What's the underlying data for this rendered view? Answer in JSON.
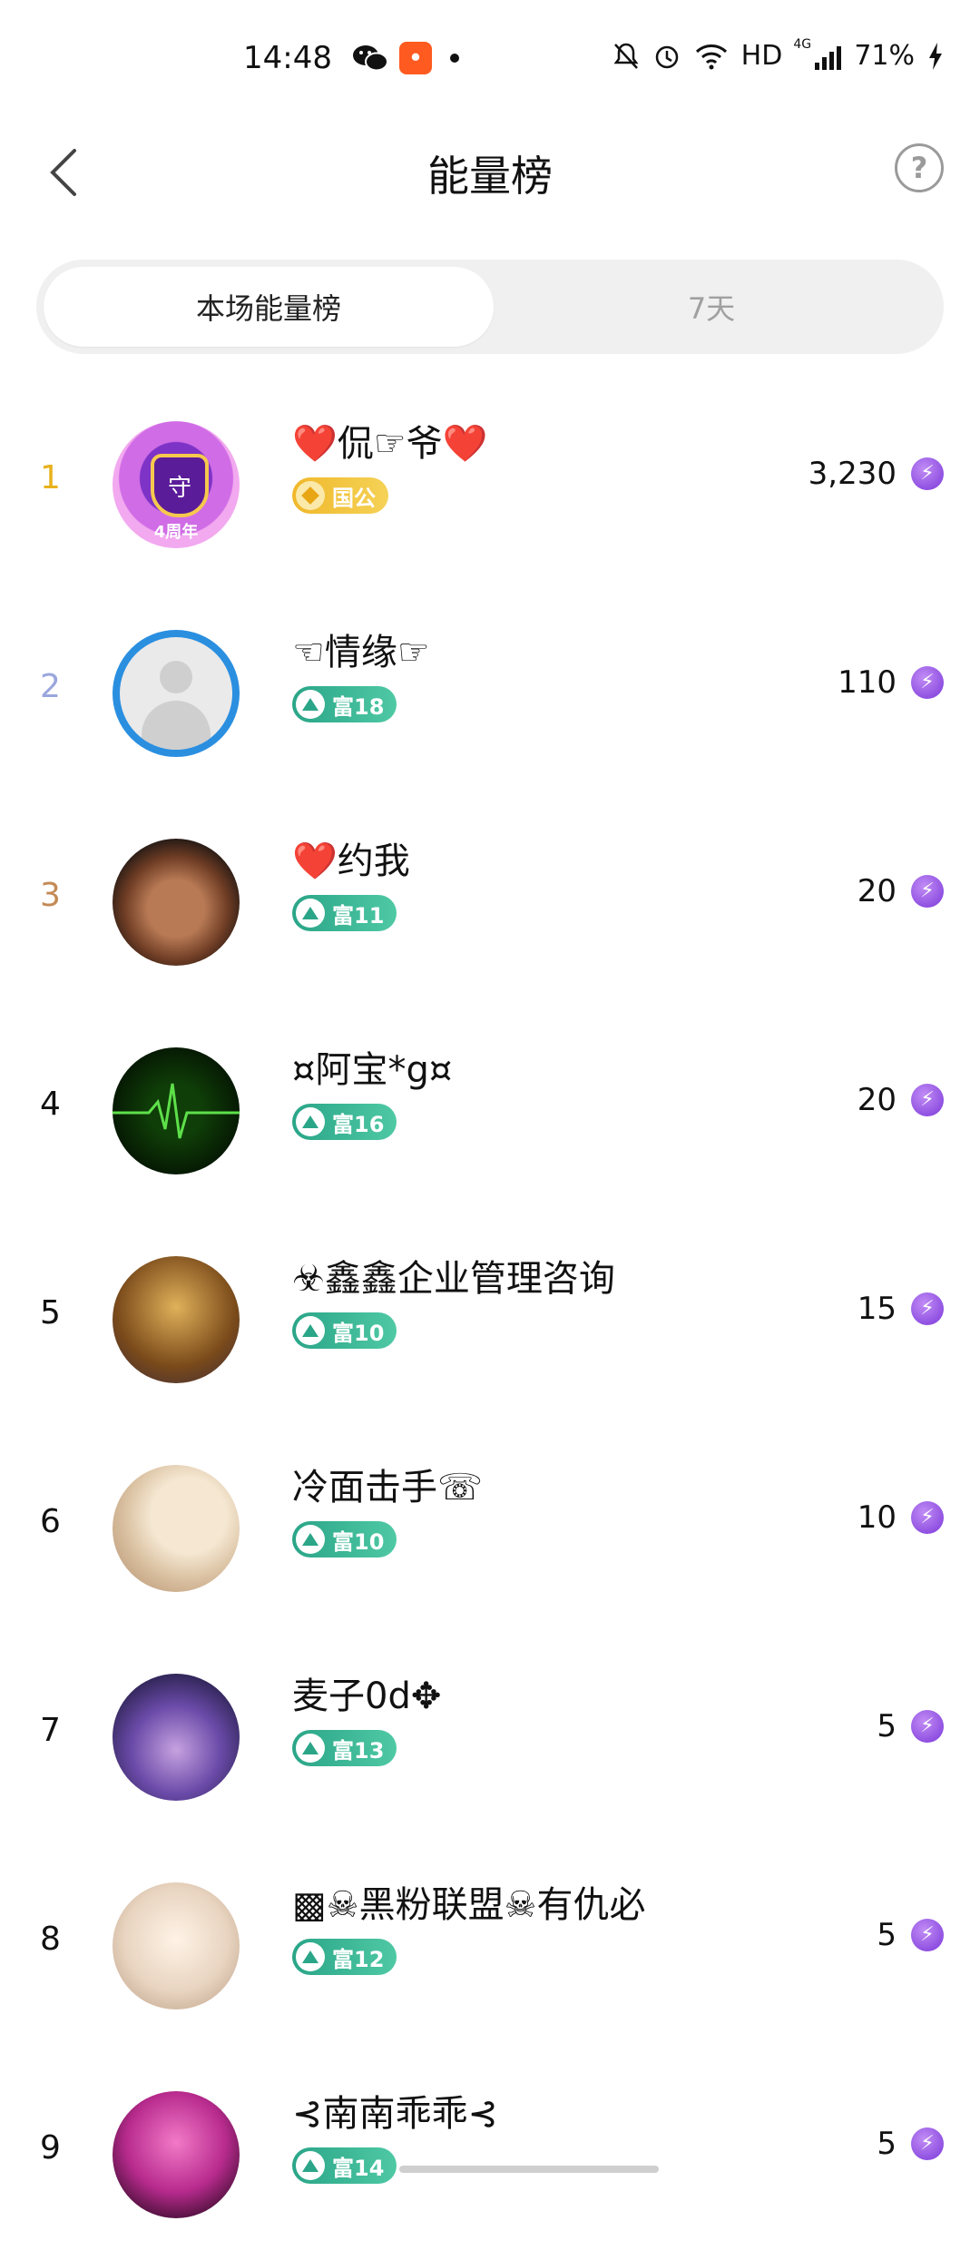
{
  "status_bar": {
    "time": "14:48",
    "network": "HD",
    "signal_label": "4G",
    "battery": "71%"
  },
  "header": {
    "title": "能量榜",
    "help_label": "?"
  },
  "tabs": [
    {
      "label": "本场能量榜",
      "active": true
    },
    {
      "label": "7天",
      "active": false
    }
  ],
  "colors": {
    "rank_1": "#e8b21e",
    "rank_2": "#9aa6dd",
    "rank_3": "#c48a55",
    "rank_default": "#111111",
    "wealth_badge": "#2aa588",
    "gov_badge": "#f0b82a",
    "energy_icon": "#8a3fe0"
  },
  "leaderboard": [
    {
      "rank": "1",
      "name": "❤️侃☞爷❤️",
      "badge_type": "gov",
      "badge": "国公",
      "score": "3,230",
      "avatar_text": "守",
      "avatar_label": "4周年"
    },
    {
      "rank": "2",
      "name": "☜情缘☞",
      "badge_type": "wealth",
      "badge": "富18",
      "score": "110"
    },
    {
      "rank": "3",
      "name": "❤️约我",
      "badge_type": "wealth",
      "badge": "富11",
      "score": "20"
    },
    {
      "rank": "4",
      "name": "¤阿宝*g¤",
      "badge_type": "wealth",
      "badge": "富16",
      "score": "20"
    },
    {
      "rank": "5",
      "name": "☣鑫鑫企业管理咨询",
      "badge_type": "wealth",
      "badge": "富10",
      "score": "15"
    },
    {
      "rank": "6",
      "name": "冷面击手☏",
      "badge_type": "wealth",
      "badge": "富10",
      "score": "10"
    },
    {
      "rank": "7",
      "name": "麦子0d✥",
      "badge_type": "wealth",
      "badge": "富13",
      "score": "5"
    },
    {
      "rank": "8",
      "name": "▩☠黑粉联盟☠有仇必",
      "badge_type": "wealth",
      "badge": "富12",
      "score": "5"
    },
    {
      "rank": "9",
      "name": "⊰南南乖乖⊰",
      "badge_type": "wealth",
      "badge": "富14",
      "score": "5"
    }
  ]
}
